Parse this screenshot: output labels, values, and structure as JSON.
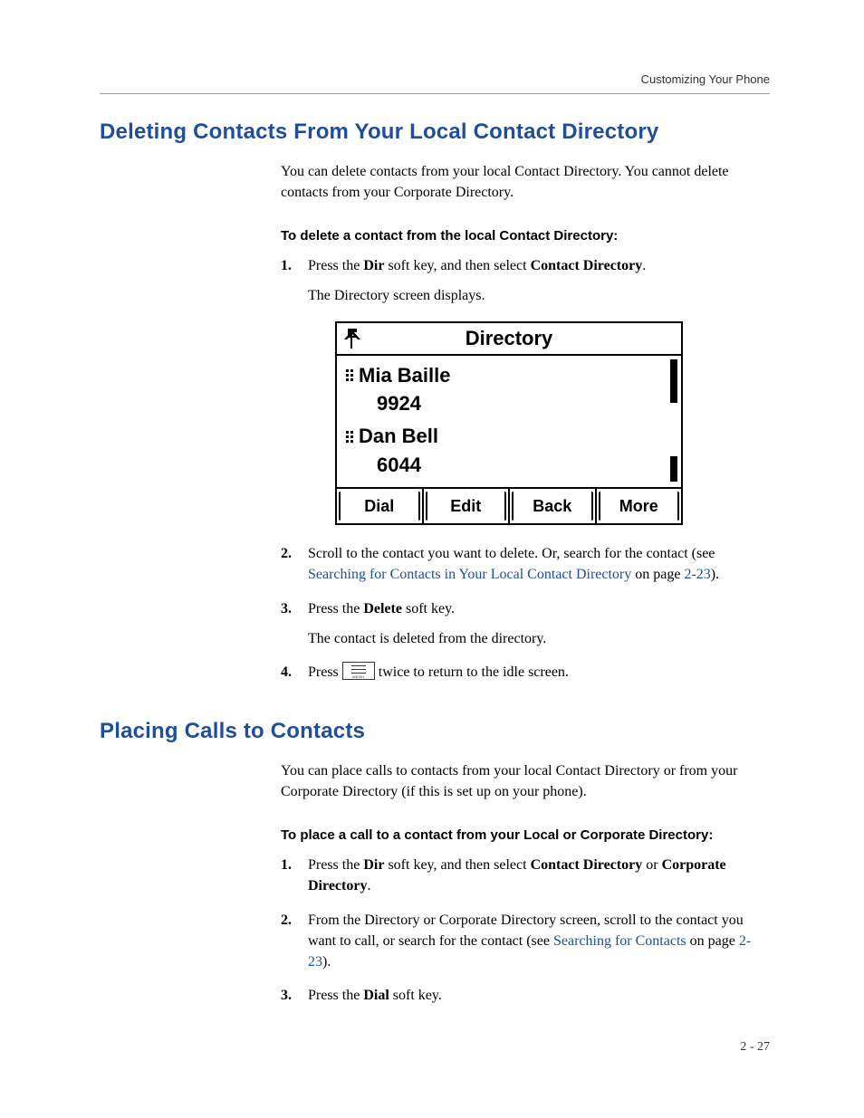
{
  "header": {
    "running": "Customizing Your Phone"
  },
  "section1": {
    "title": "Deleting Contacts From Your Local Contact Directory",
    "intro": "You can delete contacts from your local Contact Directory. You cannot delete contacts from your Corporate Directory.",
    "subhead": "To delete a contact from the local Contact Directory:",
    "step1_a": "Press the ",
    "step1_b": "Dir",
    "step1_c": " soft key, and then select ",
    "step1_d": "Contact Directory",
    "step1_e": ".",
    "step1_sub": "The Directory screen displays.",
    "step2_a": "Scroll to the contact you want to delete. Or, search for the contact (see ",
    "step2_link": "Searching for Contacts in Your Local Contact Directory",
    "step2_b": " on page ",
    "step2_page": "2-23",
    "step2_c": ").",
    "step3_a": "Press the ",
    "step3_b": "Delete",
    "step3_c": " soft key.",
    "step3_sub": "The contact is deleted from the directory.",
    "step4_a": "Press  ",
    "step4_b": "  twice to return to the idle screen."
  },
  "screen": {
    "title": "Directory",
    "contacts": [
      {
        "name": "Mia Baille",
        "ext": "9924"
      },
      {
        "name": "Dan Bell",
        "ext": "6044"
      }
    ],
    "softkeys": [
      "Dial",
      "Edit",
      "Back",
      "More"
    ]
  },
  "section2": {
    "title": "Placing Calls to Contacts",
    "intro": "You can place calls to contacts from your local Contact Directory or from your Corporate Directory (if this is set up on your phone).",
    "subhead": "To place a call to a contact from your Local or Corporate Directory:",
    "step1_a": "Press the ",
    "step1_b": "Dir",
    "step1_c": " soft key, and then select ",
    "step1_d": "Contact Directory",
    "step1_e": " or ",
    "step1_f": "Corporate Directory",
    "step1_g": ".",
    "step2_a": "From the Directory or Corporate Directory screen, scroll to the contact you want to call, or search for the contact (see ",
    "step2_link": "Searching for Contacts",
    "step2_b": " on page ",
    "step2_page": "2-23",
    "step2_c": ").",
    "step3_a": "Press the ",
    "step3_b": "Dial",
    "step3_c": " soft key."
  },
  "footer": {
    "page": "2 - 27"
  }
}
